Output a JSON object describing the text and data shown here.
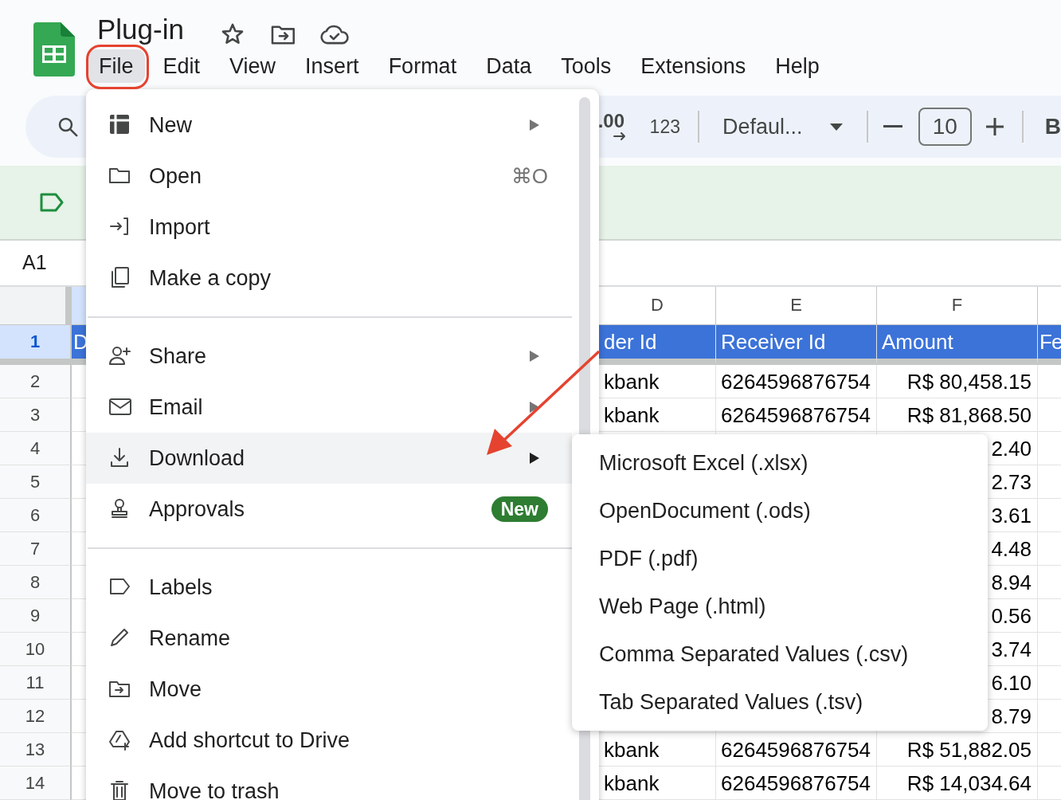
{
  "app": {
    "title": "Plug-in"
  },
  "menu_bar": [
    {
      "label": "File",
      "selected": true
    },
    {
      "label": "Edit",
      "selected": false
    },
    {
      "label": "View",
      "selected": false
    },
    {
      "label": "Insert",
      "selected": false
    },
    {
      "label": "Format",
      "selected": false
    },
    {
      "label": "Data",
      "selected": false
    },
    {
      "label": "Tools",
      "selected": false
    },
    {
      "label": "Extensions",
      "selected": false
    },
    {
      "label": "Help",
      "selected": false
    }
  ],
  "toolbar": {
    "decimal_label": ".00",
    "number_format": "123",
    "font": "Defaul...",
    "font_size": "10",
    "bold": "B"
  },
  "name_box": "A1",
  "grid": {
    "columns": [
      "D",
      "E",
      "F"
    ],
    "rows": [
      {
        "number": "1",
        "selected": true,
        "kind": "header",
        "c": "D",
        "d": "der Id",
        "e": "Receiver Id",
        "f": "Amount",
        "g": "Fe"
      },
      {
        "number": "2",
        "selected": false,
        "kind": "data",
        "d": "kbank",
        "e": "6264596876754",
        "f": "R$ 80,458.15"
      },
      {
        "number": "3",
        "selected": false,
        "kind": "data",
        "d": "kbank",
        "e": "6264596876754",
        "f": "R$ 81,868.50"
      },
      {
        "number": "4",
        "selected": false,
        "kind": "data",
        "f": "2.40"
      },
      {
        "number": "5",
        "selected": false,
        "kind": "data",
        "f": "2.73"
      },
      {
        "number": "6",
        "selected": false,
        "kind": "data",
        "f": "3.61"
      },
      {
        "number": "7",
        "selected": false,
        "kind": "data",
        "f": "4.48"
      },
      {
        "number": "8",
        "selected": false,
        "kind": "data",
        "f": "8.94"
      },
      {
        "number": "9",
        "selected": false,
        "kind": "data",
        "f": "0.56"
      },
      {
        "number": "10",
        "selected": false,
        "kind": "data",
        "f": "3.74"
      },
      {
        "number": "11",
        "selected": false,
        "kind": "data",
        "f": "6.10"
      },
      {
        "number": "12",
        "selected": false,
        "kind": "data",
        "f": "8.79"
      },
      {
        "number": "13",
        "selected": false,
        "kind": "data",
        "d": "kbank",
        "e": "6264596876754",
        "f": "R$ 51,882.05"
      },
      {
        "number": "14",
        "selected": false,
        "kind": "data",
        "d": "kbank",
        "e": "6264596876754",
        "f": "R$ 14,034.64"
      }
    ]
  },
  "file_menu": {
    "items": [
      {
        "kind": "item",
        "label": "New",
        "submenu": true,
        "highlighted": false
      },
      {
        "kind": "item",
        "label": "Open",
        "shortcut": "⌘O",
        "highlighted": false
      },
      {
        "kind": "item",
        "label": "Import",
        "highlighted": false
      },
      {
        "kind": "item",
        "label": "Make a copy",
        "highlighted": false
      },
      {
        "kind": "divider"
      },
      {
        "kind": "item",
        "label": "Share",
        "submenu": true,
        "highlighted": false
      },
      {
        "kind": "item",
        "label": "Email",
        "submenu": true,
        "highlighted": false
      },
      {
        "kind": "item",
        "label": "Download",
        "submenu": true,
        "highlighted": true
      },
      {
        "kind": "item",
        "label": "Approvals",
        "badge": "New",
        "highlighted": false
      },
      {
        "kind": "divider"
      },
      {
        "kind": "item",
        "label": "Labels",
        "highlighted": false
      },
      {
        "kind": "item",
        "label": "Rename",
        "highlighted": false
      },
      {
        "kind": "item",
        "label": "Move",
        "highlighted": false
      },
      {
        "kind": "item",
        "label": "Add shortcut to Drive",
        "highlighted": false
      },
      {
        "kind": "item",
        "label": "Move to trash",
        "highlighted": false
      }
    ]
  },
  "download_submenu": {
    "items": [
      "Microsoft Excel (.xlsx)",
      "OpenDocument (.ods)",
      "PDF (.pdf)",
      "Web Page (.html)",
      "Comma Separated Values (.csv)",
      "Tab Separated Values (.tsv)"
    ]
  }
}
